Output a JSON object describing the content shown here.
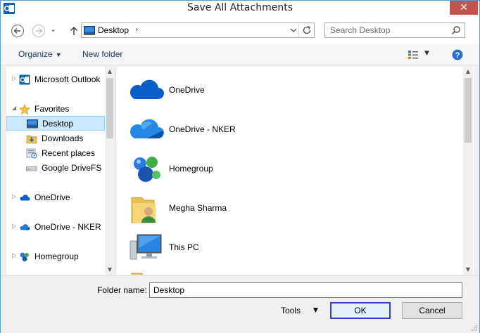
{
  "window": {
    "title": "Save All Attachments",
    "close_glyph": "✕"
  },
  "address": {
    "path": "Desktop",
    "chevron": "›"
  },
  "search": {
    "placeholder": "Search Desktop"
  },
  "toolbar": {
    "organize": "Organize",
    "new_folder": "New folder"
  },
  "nav_items": [
    {
      "label": "Microsoft Outlook",
      "icon": "outlook-icon"
    },
    {
      "label": "Favorites",
      "icon": "star-icon"
    },
    {
      "label": "Desktop",
      "icon": "desktop-icon",
      "selected": true
    },
    {
      "label": "Downloads",
      "icon": "downloads-icon"
    },
    {
      "label": "Recent places",
      "icon": "recent-places-icon"
    },
    {
      "label": "Google DriveFS",
      "icon": "drive-icon"
    },
    {
      "label": "OneDrive",
      "icon": "onedrive-icon"
    },
    {
      "label": "OneDrive - NKER",
      "icon": "onedrive-icon"
    },
    {
      "label": "Homegroup",
      "icon": "homegroup-icon"
    }
  ],
  "files": [
    {
      "label": "OneDrive",
      "icon": "onedrive-icon"
    },
    {
      "label": "OneDrive - NKER",
      "icon": "onedrive-icon"
    },
    {
      "label": "Homegroup",
      "icon": "homegroup-icon"
    },
    {
      "label": "Megha Sharma",
      "icon": "user-folder-icon"
    },
    {
      "label": "This PC",
      "icon": "computer-icon"
    }
  ],
  "bottom": {
    "folder_name_label": "Folder name:",
    "folder_name_value": "Desktop",
    "tools": "Tools",
    "ok": "OK",
    "cancel": "Cancel"
  },
  "colors": {
    "accent": "#3a3ad0",
    "selection": "#cce8ff",
    "close": "#c75050"
  }
}
